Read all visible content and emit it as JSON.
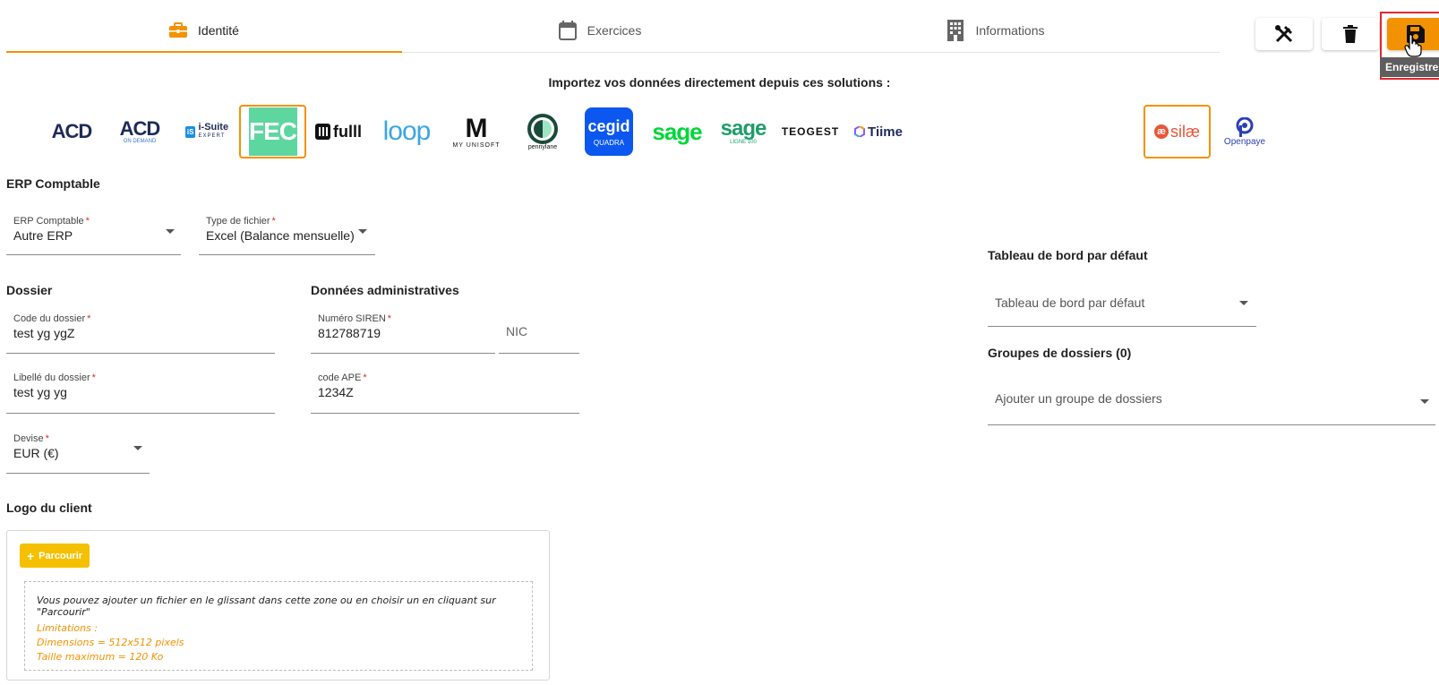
{
  "tabs": [
    {
      "label": "Identité",
      "icon": "briefcase-icon",
      "active": true
    },
    {
      "label": "Exercices",
      "icon": "calendar-icon",
      "active": false
    },
    {
      "label": "Informations",
      "icon": "building-icon",
      "active": false
    }
  ],
  "toolbar": {
    "tools_icon": "tools-icon",
    "delete_icon": "trash-icon",
    "save_icon": "floppy-disk-icon",
    "save_tooltip": "Enregistrer"
  },
  "import_title": "Importez vos données directement depuis ces solutions :",
  "logos": {
    "acd": "ACD",
    "acd_ondemand": "ACD",
    "acd_ondemand_sub": "ON DEMAND",
    "isuite": "i-Suite",
    "isuite_sub": "EXPERT",
    "isuite_badge": "iS",
    "fec": "FEC",
    "fulll": "fulll",
    "loop": "loop",
    "myunisoft": "MY UNISOFT",
    "pennylane": "pennylane",
    "cegid": "cegid",
    "cegid_sub": "QUADRA",
    "sage": "sage",
    "sage100": "sage",
    "sage100_sub": "LIGNE 100",
    "teogest": "TEOGEST",
    "tiime": "Tiime",
    "silae": "silæ",
    "openpaye": "Openpaye"
  },
  "erp": {
    "title": "ERP Comptable",
    "erp_label": "ERP Comptable",
    "erp_value": "Autre ERP",
    "type_label": "Type de fichier",
    "type_value": "Excel (Balance mensuelle)"
  },
  "dossier": {
    "title": "Dossier",
    "code_label": "Code du dossier",
    "code_value": "test yg ygZ",
    "libelle_label": "Libellé du dossier",
    "libelle_value": "test yg yg",
    "devise_label": "Devise",
    "devise_value": "EUR (€)"
  },
  "admin": {
    "title": "Données administratives",
    "siren_label": "Numéro SIREN",
    "siren_value": "812788719",
    "nic_placeholder": "NIC",
    "ape_label": "code APE",
    "ape_value": "1234Z"
  },
  "right": {
    "dashboard_title": "Tableau de bord par défaut",
    "dashboard_placeholder": "Tableau de bord par défaut",
    "groups_title": "Groupes de dossiers (0)",
    "groups_placeholder": "Ajouter un groupe de dossiers"
  },
  "logo_client": {
    "title": "Logo du client",
    "browse_label": "Parcourir",
    "drop_text": "Vous pouvez ajouter un fichier en le glissant dans cette zone ou en choisir un en cliquant sur \"Parcourir\"",
    "limits_title": "Limitations :",
    "dimensions": "Dimensions = 512x512 pixels",
    "max_size": "Taille maximum = 120 Ko"
  },
  "colors": {
    "accent": "#f39200",
    "required": "#e0282e",
    "browse": "#f5c000",
    "cegid": "#0b57f0",
    "sage": "#00d639",
    "fec": "#5ed6a0"
  }
}
